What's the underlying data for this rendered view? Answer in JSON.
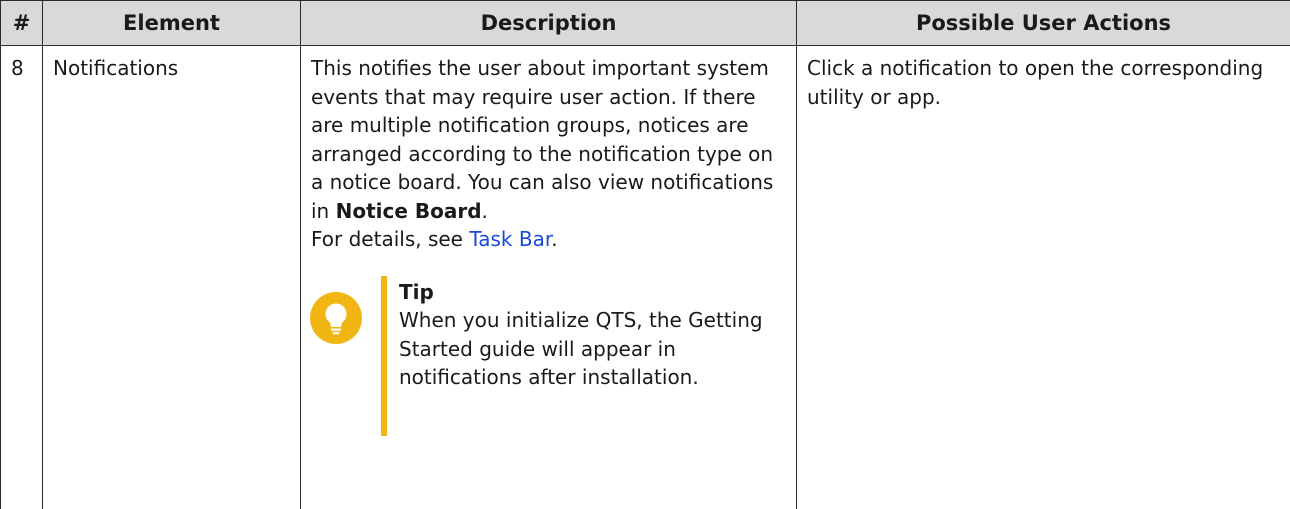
{
  "table": {
    "headers": [
      "#",
      "Element",
      "Description",
      "Possible User Actions"
    ],
    "row": {
      "number": "8",
      "element": "Notifications",
      "description_intro": "This notifies the user about important system events that may require user action. If there are multiple notification groups, notices are arranged according to the notification type on a notice board. You can also view notifications in ",
      "description_bold": "Notice Board",
      "description_period": ".",
      "details_prefix": "For details, see ",
      "details_link": "Task Bar",
      "details_suffix": ".",
      "tip_title": "Tip",
      "tip_text": "When you initialize QTS, the Getting Started guide will appear in notifications after installation.",
      "actions": "Click a notification to open the corresponding utility or app."
    }
  },
  "colors": {
    "header_bg": "#d9d9d9",
    "link": "#1a4bd8",
    "tip_accent": "#f2b614"
  },
  "icons": {
    "tip": "lightbulb-icon"
  }
}
